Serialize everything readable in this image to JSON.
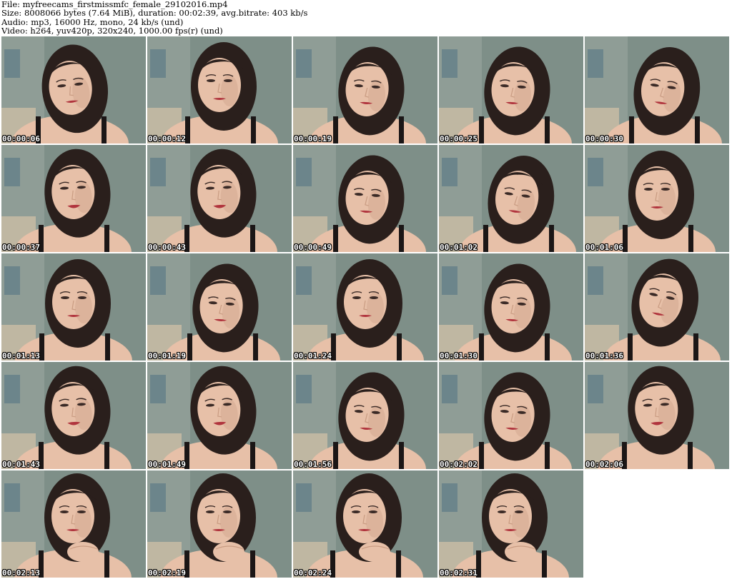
{
  "header": {
    "file_line": "File: myfreecams_firstmissmfc_female_29102016.mp4",
    "size_line": "Size: 8008066 bytes (7.64 MiB), duration: 00:02:39, avg.bitrate: 403 kb/s",
    "audio_line": "Audio: mp3, 16000 Hz, mono, 24 kb/s (und)",
    "video_line": "Video: h264, yuv420p, 320x240, 1000.00 fps(r) (und)"
  },
  "colors": {
    "wall": "#7e8f88",
    "wall_light": "#a3b0a9",
    "hair": "#2a1f1c",
    "skin": "#e7c0a8",
    "skin_shadow": "#c99c83",
    "lips": "#b0343d",
    "strap": "#1b1616",
    "curtain": "#c8bca4",
    "timestamp": "#ffffff"
  },
  "thumbnails": [
    {
      "timestamp": "00:00:06",
      "pose": "down-left"
    },
    {
      "timestamp": "00:00:12",
      "pose": "front"
    },
    {
      "timestamp": "00:00:19",
      "pose": "down"
    },
    {
      "timestamp": "00:00:25",
      "pose": "down"
    },
    {
      "timestamp": "00:00:30",
      "pose": "down-right"
    },
    {
      "timestamp": "00:00:37",
      "pose": "front-smile"
    },
    {
      "timestamp": "00:00:43",
      "pose": "front-smile"
    },
    {
      "timestamp": "00:00:49",
      "pose": "down"
    },
    {
      "timestamp": "00:01:02",
      "pose": "down-right"
    },
    {
      "timestamp": "00:01:06",
      "pose": "front"
    },
    {
      "timestamp": "00:01:13",
      "pose": "front"
    },
    {
      "timestamp": "00:01:19",
      "pose": "down"
    },
    {
      "timestamp": "00:01:24",
      "pose": "front"
    },
    {
      "timestamp": "00:01:30",
      "pose": "down"
    },
    {
      "timestamp": "00:01:36",
      "pose": "tilt"
    },
    {
      "timestamp": "00:01:43",
      "pose": "front-smile"
    },
    {
      "timestamp": "00:01:49",
      "pose": "front-smile"
    },
    {
      "timestamp": "00:01:56",
      "pose": "down"
    },
    {
      "timestamp": "00:02:02",
      "pose": "down"
    },
    {
      "timestamp": "00:02:06",
      "pose": "front-smile"
    },
    {
      "timestamp": "00:02:13",
      "pose": "hand"
    },
    {
      "timestamp": "00:02:19",
      "pose": "hand"
    },
    {
      "timestamp": "00:02:24",
      "pose": "hand"
    },
    {
      "timestamp": "00:02:31",
      "pose": "hand"
    }
  ]
}
